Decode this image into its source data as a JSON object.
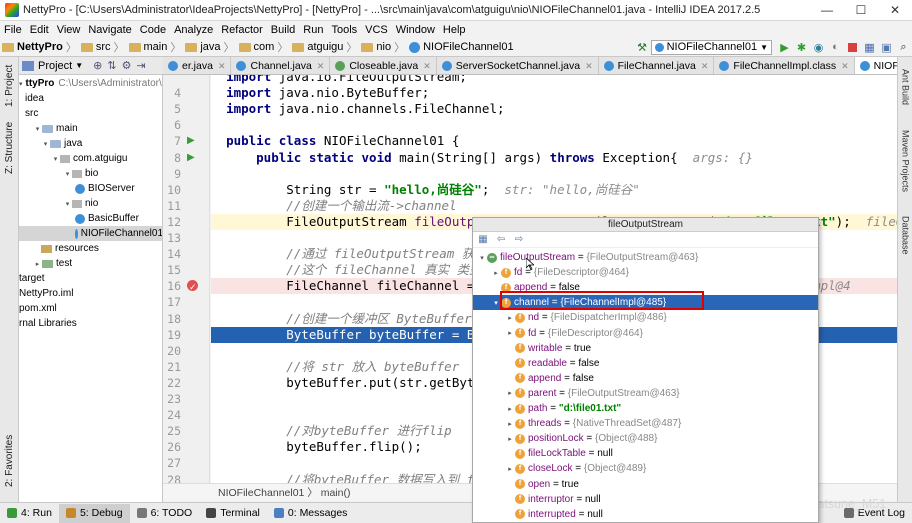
{
  "window": {
    "title": "NettyPro - [C:\\Users\\Administrator\\IdeaProjects\\NettyPro] - [NettyPro] - ...\\src\\main\\java\\com\\atguigu\\nio\\NIOFileChannel01.java - IntelliJ IDEA 2017.2.5",
    "min": "—",
    "max": "☐",
    "close": "✕"
  },
  "menu": [
    "File",
    "Edit",
    "View",
    "Navigate",
    "Code",
    "Analyze",
    "Refactor",
    "Build",
    "Run",
    "Tools",
    "VCS",
    "Window",
    "Help"
  ],
  "breadcrumbs": [
    "NettyPro",
    "src",
    "main",
    "java",
    "com",
    "atguigu",
    "nio",
    "NIOFileChannel01"
  ],
  "run_config": "NIOFileChannel01",
  "left_tools": [
    "1: Project",
    "Z: Structure",
    "2: Favorites"
  ],
  "right_tools": [
    "Ant Build",
    "Maven Projects",
    "Database"
  ],
  "project": {
    "header": "Project",
    "tree": [
      {
        "label": "ttyPro",
        "extra": "C:\\Users\\Administrator\\Idea",
        "icon": "folder",
        "bold": true
      },
      {
        "label": "idea",
        "icon": "none"
      },
      {
        "label": "src",
        "icon": "none"
      },
      {
        "label": "main",
        "icon": "folder"
      },
      {
        "label": "java",
        "icon": "folder"
      },
      {
        "label": "com.atguigu",
        "icon": "package"
      },
      {
        "label": "bio",
        "icon": "package"
      },
      {
        "label": "BIOServer",
        "icon": "class"
      },
      {
        "label": "nio",
        "icon": "package"
      },
      {
        "label": "BasicBuffer",
        "icon": "class"
      },
      {
        "label": "NIOFileChannel01",
        "icon": "class",
        "selected": true
      },
      {
        "label": "resources",
        "icon": "resources"
      },
      {
        "label": "test",
        "icon": "test"
      },
      {
        "label": "target",
        "icon": "none"
      },
      {
        "label": "NettyPro.iml",
        "icon": "none"
      },
      {
        "label": "pom.xml",
        "icon": "none"
      },
      {
        "label": "rnal Libraries",
        "icon": "none"
      }
    ]
  },
  "tabs": [
    {
      "label": "er.java",
      "icon": "class"
    },
    {
      "label": "Channel.java",
      "icon": "class"
    },
    {
      "label": "Closeable.java",
      "icon": "interface"
    },
    {
      "label": "ServerSocketChannel.java",
      "icon": "class"
    },
    {
      "label": "FileChannel.java",
      "icon": "class"
    },
    {
      "label": "FileChannelImpl.class",
      "icon": "class"
    },
    {
      "label": "NIOFileChannel01.java",
      "icon": "class",
      "active": true
    }
  ],
  "code": [
    {
      "n": "",
      "html": "<span class=\"kw\">import</span> java.io.FileOutputStream;"
    },
    {
      "n": "4",
      "html": "<span class=\"kw\">import</span> java.nio.ByteBuffer;"
    },
    {
      "n": "5",
      "html": "<span class=\"kw\">import</span> java.nio.channels.FileChannel;"
    },
    {
      "n": "6",
      "html": ""
    },
    {
      "n": "7",
      "html": "<span class=\"kw\">public class</span> NIOFileChannel01 {",
      "mark": "run"
    },
    {
      "n": "8",
      "html": "    <span class=\"kw\">public static void</span> main(String[] args) <span class=\"kw\">throws</span> Exception{  <span class=\"hint\">args: {}</span>",
      "mark": "run"
    },
    {
      "n": "9",
      "html": ""
    },
    {
      "n": "10",
      "html": "        String str = <span class=\"str\">\"hello,尚硅谷\"</span>;  <span class=\"hint\">str: \"hello,尚硅谷\"</span>"
    },
    {
      "n": "11",
      "html": "        <span class=\"cm\">//创建一个输出流->channel</span>"
    },
    {
      "n": "12",
      "html": "        FileOutputStream <span class=\"fld\">fileOutputStream</span> = <span class=\"kw\">new</span> FileOutputStream(<span class=\"str\">\"d:\\\\file01.txt\"</span>);  <span class=\"hint\">fileOutputS</span>",
      "mark": "bulb",
      "cls": "cur"
    },
    {
      "n": "13",
      "html": ""
    },
    {
      "n": "14",
      "html": "        <span class=\"cm\">//通过 fileOutputStream 获取</span>"
    },
    {
      "n": "15",
      "html": "        <span class=\"cm\">//这个 fileChannel 真实 类型</span>"
    },
    {
      "n": "16",
      "html": "        FileChannel fileChannel = fi                                   <span class=\"hint\">hannelImpl@4</span>",
      "mark": "bp",
      "cls": "err"
    },
    {
      "n": "17",
      "html": ""
    },
    {
      "n": "18",
      "html": "        <span class=\"cm\">//创建一个缓冲区 ByteBuffer</span>"
    },
    {
      "n": "19",
      "html": "        ByteBuffer byteBuffer = Byte",
      "cls": "exec"
    },
    {
      "n": "20",
      "html": ""
    },
    {
      "n": "21",
      "html": "        <span class=\"cm\">//将 str 放入 byteBuffer</span>"
    },
    {
      "n": "22",
      "html": "        byteBuffer.put(str.getBytes("
    },
    {
      "n": "23",
      "html": ""
    },
    {
      "n": "24",
      "html": ""
    },
    {
      "n": "25",
      "html": "        <span class=\"cm\">//对byteBuffer 进行flip</span>"
    },
    {
      "n": "26",
      "html": "        byteBuffer.flip();"
    },
    {
      "n": "27",
      "html": ""
    },
    {
      "n": "28",
      "html": "        <span class=\"cm\">//将byteBuffer 数据写入到 fil</span>"
    },
    {
      "n": "",
      "html": "        fileChannel.write(byteBuffe"
    }
  ],
  "editor_crumbs": "NIOFileChannel01  〉 main()",
  "popup": {
    "title": "fileOutputStream",
    "rows": [
      {
        "indent": 0,
        "tri": "▼",
        "icon": "obj",
        "name": "fileOutputStream",
        "eq": " = ",
        "val": "{FileOutputStream@463}"
      },
      {
        "indent": 1,
        "tri": "▶",
        "icon": "f",
        "name": "fd",
        "eq": " = ",
        "val": "{FileDescriptor@464}"
      },
      {
        "indent": 1,
        "tri": "",
        "icon": "f",
        "name": "append",
        "eq": " = ",
        "plain": "false"
      },
      {
        "indent": 1,
        "tri": "▼",
        "icon": "f",
        "name": "channel",
        "eq": " = ",
        "val": "{FileChannelImpl@485}",
        "selected": true
      },
      {
        "indent": 2,
        "tri": "▶",
        "icon": "f",
        "name": "nd",
        "eq": " = ",
        "val": "{FileDispatcherImpl@486}"
      },
      {
        "indent": 2,
        "tri": "▶",
        "icon": "f",
        "name": "fd",
        "eq": " = ",
        "val": "{FileDescriptor@464}"
      },
      {
        "indent": 2,
        "tri": "",
        "icon": "f",
        "name": "writable",
        "eq": " = ",
        "plain": "true"
      },
      {
        "indent": 2,
        "tri": "",
        "icon": "f",
        "name": "readable",
        "eq": " = ",
        "plain": "false"
      },
      {
        "indent": 2,
        "tri": "",
        "icon": "f",
        "name": "append",
        "eq": " = ",
        "plain": "false"
      },
      {
        "indent": 2,
        "tri": "▶",
        "icon": "f",
        "name": "parent",
        "eq": " = ",
        "val": "{FileOutputStream@463}"
      },
      {
        "indent": 2,
        "tri": "▶",
        "icon": "f",
        "name": "path",
        "eq": " = ",
        "str": "\"d:\\file01.txt\""
      },
      {
        "indent": 2,
        "tri": "▶",
        "icon": "f",
        "name": "threads",
        "eq": " = ",
        "val": "{NativeThreadSet@487}"
      },
      {
        "indent": 2,
        "tri": "▶",
        "icon": "f",
        "name": "positionLock",
        "eq": " = ",
        "val": "{Object@488}"
      },
      {
        "indent": 2,
        "tri": "",
        "icon": "f",
        "name": "fileLockTable",
        "eq": " = ",
        "plain": "null"
      },
      {
        "indent": 2,
        "tri": "▶",
        "icon": "f",
        "name": "closeLock",
        "eq": " = ",
        "val": "{Object@489}"
      },
      {
        "indent": 2,
        "tri": "",
        "icon": "f",
        "name": "open",
        "eq": " = ",
        "plain": "true"
      },
      {
        "indent": 2,
        "tri": "",
        "icon": "f",
        "name": "interruptor",
        "eq": " = ",
        "plain": "null"
      },
      {
        "indent": 2,
        "tri": "",
        "icon": "f",
        "name": "interrupted",
        "eq": " = ",
        "plain": "null"
      }
    ]
  },
  "status": [
    {
      "label": "4: Run",
      "color": "#3a9a3a"
    },
    {
      "label": "5: Debug",
      "color": "#c4882a",
      "active": true
    },
    {
      "label": "6: TODO",
      "color": "#777777"
    },
    {
      "label": "Terminal",
      "color": "#444444"
    },
    {
      "label": "0: Messages",
      "color": "#4a7fc0"
    }
  ],
  "event_log": "Event Log",
  "watermark": "https://blog.csdn.net/Hatsune_M51"
}
